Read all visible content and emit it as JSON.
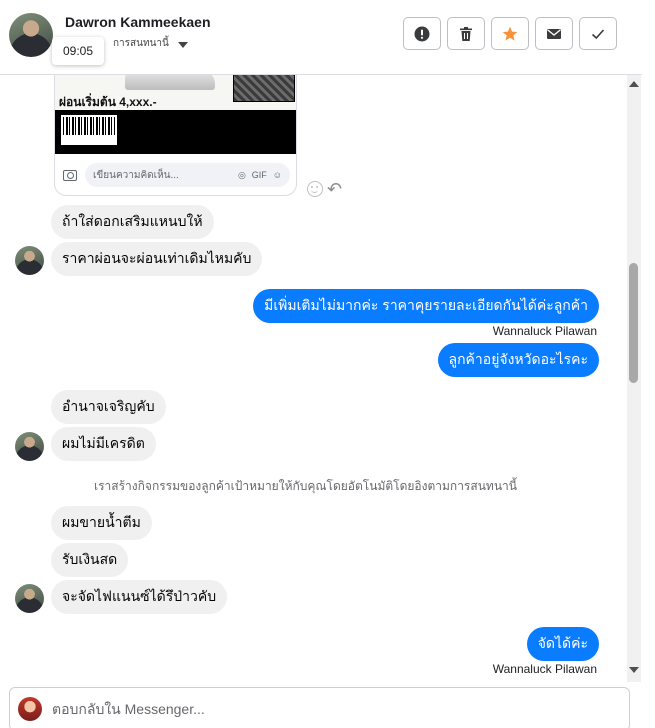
{
  "header": {
    "contact_name": "Dawron Kammeekaen",
    "sub_label": "การสนทนานี้",
    "time_tooltip": "09:05",
    "actions": [
      {
        "name": "alert-button",
        "icon": "exclamation-icon"
      },
      {
        "name": "delete-button",
        "icon": "trash-icon"
      },
      {
        "name": "star-button",
        "icon": "star-icon",
        "color": "#f7923a"
      },
      {
        "name": "mail-button",
        "icon": "envelope-icon"
      },
      {
        "name": "done-button",
        "icon": "check-icon"
      }
    ]
  },
  "image_card": {
    "price_text": "ผ่อนเริ่มต้น 4,xxx.-",
    "comment_placeholder": "เขียนความคิดเห็น...",
    "gif_label": "GIF"
  },
  "messages": [
    {
      "id": "m1",
      "dir": "in",
      "text": "ถ้าใส่ดอกเสริมแหนบให้"
    },
    {
      "id": "m2",
      "dir": "in",
      "text": "ราคาผ่อนจะผ่อนเท่าเดิมไหมคับ"
    },
    {
      "id": "m3",
      "dir": "out",
      "text": "มีเพิ่มเติมไม่มากค่ะ  ราคาคุยรายละเอียดกันได้ค่ะลูกค้า"
    },
    {
      "id": "m4",
      "dir": "out",
      "text": "ลูกค้าอยู่จังหวัดอะไรคะ"
    },
    {
      "id": "m5",
      "dir": "in",
      "text": "อำนาจเจริญคับ"
    },
    {
      "id": "m6",
      "dir": "in",
      "text": "ผมไม่มีเครดิต"
    },
    {
      "id": "m7",
      "dir": "in",
      "text": "ผมขายน้ำตีม"
    },
    {
      "id": "m8",
      "dir": "in",
      "text": "รับเงินสด"
    },
    {
      "id": "m9",
      "dir": "in",
      "text": "จะจัดไฟแนนซ์ได้รึป่าวคับ"
    },
    {
      "id": "m10",
      "dir": "out",
      "text": "จัดได้ค่ะ"
    }
  ],
  "sender_labels": {
    "agent": "Wannaluck Pilawan"
  },
  "system_note": "เราสร้างกิจกรรมของลูกค้าเป้าหมายให้กับคุณโดยอัตโนมัติโดยอิงตามการสนทนานี้",
  "composer": {
    "placeholder": "ตอบกลับใน Messenger..."
  },
  "colors": {
    "outgoing_bubble": "#0a7cff",
    "incoming_bubble": "#f0f0f0",
    "star_accent": "#f7923a"
  }
}
